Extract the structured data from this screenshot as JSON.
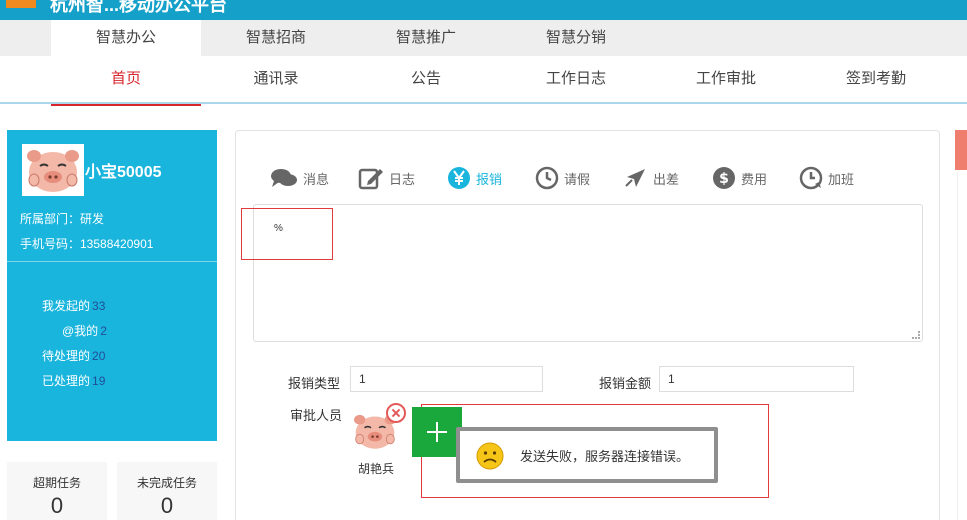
{
  "header": {
    "title": "杭州智...移动办公平台"
  },
  "module_tabs": [
    {
      "label": "智慧办公",
      "active": true
    },
    {
      "label": "智慧招商",
      "active": false
    },
    {
      "label": "智慧推广",
      "active": false
    },
    {
      "label": "智慧分销",
      "active": false
    }
  ],
  "sub_nav": [
    {
      "label": "首页",
      "active": true
    },
    {
      "label": "通讯录",
      "active": false
    },
    {
      "label": "公告",
      "active": false
    },
    {
      "label": "工作日志",
      "active": false
    },
    {
      "label": "工作审批",
      "active": false
    },
    {
      "label": "签到考勤",
      "active": false
    }
  ],
  "profile": {
    "username": "小宝50005",
    "department": "所属部门：研发",
    "phone": "手机号码：13588420901",
    "stats": [
      {
        "label": "我发起的",
        "value": "33"
      },
      {
        "label": "@我的",
        "value": "2"
      },
      {
        "label": "待处理的",
        "value": "20"
      },
      {
        "label": "已处理的",
        "value": "19"
      }
    ]
  },
  "tasks": [
    {
      "label": "超期任务",
      "value": "0"
    },
    {
      "label": "未完成任务",
      "value": "0"
    }
  ],
  "post_tabs": [
    {
      "label": "消息",
      "icon": "chat-bubble-icon",
      "active": false
    },
    {
      "label": "日志",
      "icon": "edit-note-icon",
      "active": false
    },
    {
      "label": "报销",
      "icon": "yen-icon",
      "active": true
    },
    {
      "label": "请假",
      "icon": "clock-icon",
      "active": false
    },
    {
      "label": "出差",
      "icon": "airplane-icon",
      "active": false
    },
    {
      "label": "费用",
      "icon": "dollar-icon",
      "active": false
    },
    {
      "label": "加班",
      "icon": "clock-arrow-icon",
      "active": false
    }
  ],
  "form": {
    "content": "%",
    "reimburse_type_label": "报销类型",
    "reimburse_type_value": "1",
    "reimburse_amount_label": "报销金额",
    "reimburse_amount_value": "1",
    "approver_label": "审批人员",
    "approver_name": "胡艳兵"
  },
  "toast": {
    "message": "发送失败，服务器连接错误。"
  },
  "colors": {
    "brand": "#1ab5dd",
    "active_nav": "#d6262c",
    "add_button": "#1aa83d"
  }
}
